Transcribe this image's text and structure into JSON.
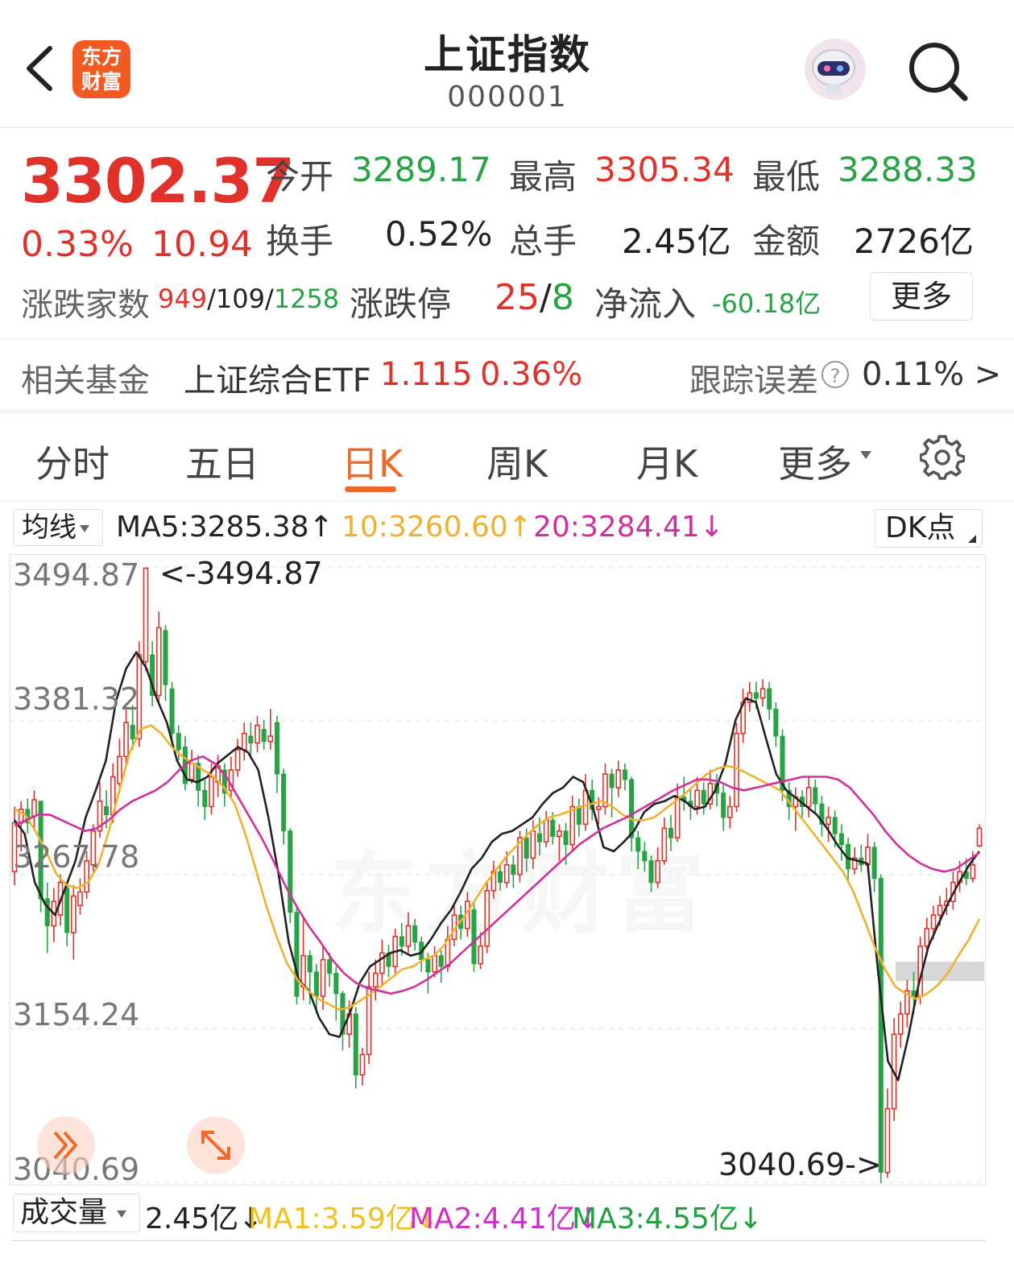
{
  "header": {
    "title": "上证指数",
    "code": "000001",
    "logo_text": "东方财富"
  },
  "quote": {
    "price": "3302.37",
    "change_pct": "0.33%",
    "change": "10.94",
    "open_label": "今开",
    "open": "3289.17",
    "high_label": "最高",
    "high": "3305.34",
    "low_label": "最低",
    "low": "3288.33",
    "turnover_label": "换手",
    "turnover": "0.52%",
    "volume_label": "总手",
    "volume": "2.45亿",
    "amount_label": "金额",
    "amount": "2726亿",
    "updown_label": "涨跌家数",
    "up_count": "949",
    "flat_count": "109",
    "down_count": "1258",
    "limit_label": "涨跌停",
    "limit_up": "25",
    "limit_down": "8",
    "netflow_label": "净流入",
    "netflow": "-60.18亿",
    "more_label": "更多",
    "colors": {
      "up": "#e0312a",
      "down": "#27a245"
    }
  },
  "fund": {
    "label": "相关基金",
    "name": "上证综合ETF",
    "price": "1.115",
    "pct": "0.36%",
    "track_label": "跟踪误差",
    "track_value": "0.11% >"
  },
  "tabs": [
    {
      "label": "分时",
      "active": false
    },
    {
      "label": "五日",
      "active": false
    },
    {
      "label": "日K",
      "active": true
    },
    {
      "label": "周K",
      "active": false
    },
    {
      "label": "月K",
      "active": false
    },
    {
      "label": "更多",
      "active": false
    }
  ],
  "ma": {
    "select_label": "均线",
    "ma5": "MA5:3285.38↑",
    "ma10": "10:3260.60↑",
    "ma20": "20:3284.41↓",
    "dk_label": "DK点",
    "colors": {
      "ma5": "#222222",
      "ma10": "#f0b030",
      "ma20": "#d0309a"
    }
  },
  "chart_data": {
    "type": "candlestick",
    "y_ticks": [
      "3494.87",
      "3381.32",
      "3267.78",
      "3154.24",
      "3040.69"
    ],
    "ylim": [
      3040.69,
      3494.87
    ],
    "high_marker": "<-3494.87",
    "low_marker": "3040.69->",
    "watermark": "东方财富",
    "grid": true,
    "candles": [
      [
        3270,
        3306,
        3318,
        3260
      ],
      [
        3306,
        3316,
        3322,
        3285
      ],
      [
        3316,
        3306,
        3324,
        3298
      ],
      [
        3311,
        3323,
        3330,
        3302
      ],
      [
        3322,
        3250,
        3322,
        3240
      ],
      [
        3250,
        3230,
        3262,
        3210
      ],
      [
        3230,
        3248,
        3258,
        3218
      ],
      [
        3238,
        3262,
        3268,
        3230
      ],
      [
        3258,
        3225,
        3262,
        3215
      ],
      [
        3225,
        3252,
        3260,
        3205
      ],
      [
        3245,
        3255,
        3265,
        3238
      ],
      [
        3255,
        3278,
        3285,
        3250
      ],
      [
        3275,
        3300,
        3305,
        3268
      ],
      [
        3300,
        3322,
        3336,
        3295
      ],
      [
        3318,
        3312,
        3330,
        3302
      ],
      [
        3312,
        3340,
        3350,
        3306
      ],
      [
        3335,
        3355,
        3368,
        3328
      ],
      [
        3355,
        3380,
        3390,
        3348
      ],
      [
        3378,
        3368,
        3393,
        3360
      ],
      [
        3368,
        3430,
        3440,
        3362
      ],
      [
        3425,
        3494,
        3494,
        3418
      ],
      [
        3430,
        3400,
        3440,
        3392
      ],
      [
        3400,
        3450,
        3462,
        3395
      ],
      [
        3448,
        3408,
        3452,
        3396
      ],
      [
        3405,
        3372,
        3410,
        3365
      ],
      [
        3372,
        3360,
        3378,
        3352
      ],
      [
        3362,
        3335,
        3370,
        3330
      ],
      [
        3338,
        3350,
        3360,
        3335
      ],
      [
        3350,
        3330,
        3356,
        3318
      ],
      [
        3330,
        3318,
        3338,
        3308
      ],
      [
        3318,
        3340,
        3350,
        3312
      ],
      [
        3336,
        3348,
        3356,
        3325
      ],
      [
        3345,
        3328,
        3350,
        3318
      ],
      [
        3330,
        3345,
        3355,
        3325
      ],
      [
        3345,
        3360,
        3368,
        3340
      ],
      [
        3360,
        3372,
        3380,
        3352
      ],
      [
        3370,
        3365,
        3380,
        3356
      ],
      [
        3365,
        3378,
        3385,
        3358
      ],
      [
        3375,
        3366,
        3382,
        3360
      ],
      [
        3366,
        3370,
        3390,
        3360
      ],
      [
        3380,
        3342,
        3385,
        3328
      ],
      [
        3342,
        3300,
        3346,
        3290
      ],
      [
        3300,
        3240,
        3302,
        3232
      ],
      [
        3240,
        3178,
        3245,
        3172
      ],
      [
        3185,
        3208,
        3235,
        3175
      ],
      [
        3208,
        3196,
        3212,
        3172
      ],
      [
        3196,
        3178,
        3202,
        3165
      ],
      [
        3178,
        3205,
        3215,
        3168
      ],
      [
        3205,
        3195,
        3210,
        3185
      ],
      [
        3195,
        3180,
        3200,
        3160
      ],
      [
        3180,
        3150,
        3182,
        3138
      ],
      [
        3150,
        3165,
        3175,
        3140
      ],
      [
        3165,
        3120,
        3170,
        3110
      ],
      [
        3120,
        3135,
        3140,
        3112
      ],
      [
        3135,
        3185,
        3196,
        3128
      ],
      [
        3185,
        3195,
        3205,
        3175
      ],
      [
        3195,
        3210,
        3220,
        3185
      ],
      [
        3210,
        3200,
        3216,
        3192
      ],
      [
        3200,
        3222,
        3228,
        3195
      ],
      [
        3222,
        3215,
        3232,
        3208
      ],
      [
        3215,
        3230,
        3240,
        3210
      ],
      [
        3230,
        3218,
        3235,
        3212
      ],
      [
        3218,
        3205,
        3222,
        3196
      ],
      [
        3205,
        3196,
        3210,
        3180
      ],
      [
        3196,
        3208,
        3215,
        3192
      ],
      [
        3208,
        3200,
        3212,
        3188
      ],
      [
        3200,
        3220,
        3230,
        3196
      ],
      [
        3220,
        3238,
        3245,
        3215
      ],
      [
        3238,
        3228,
        3245,
        3220
      ],
      [
        3228,
        3248,
        3255,
        3222
      ],
      [
        3242,
        3202,
        3248,
        3196
      ],
      [
        3202,
        3215,
        3225,
        3198
      ],
      [
        3215,
        3256,
        3262,
        3210
      ],
      [
        3256,
        3270,
        3278,
        3250
      ],
      [
        3270,
        3262,
        3276,
        3256
      ],
      [
        3262,
        3275,
        3285,
        3258
      ],
      [
        3275,
        3268,
        3282,
        3258
      ],
      [
        3268,
        3295,
        3300,
        3262
      ],
      [
        3295,
        3280,
        3302,
        3270
      ],
      [
        3280,
        3300,
        3308,
        3272
      ],
      [
        3298,
        3292,
        3310,
        3282
      ],
      [
        3292,
        3308,
        3315,
        3288
      ],
      [
        3308,
        3296,
        3314,
        3290
      ],
      [
        3296,
        3300,
        3305,
        3278
      ],
      [
        3300,
        3290,
        3306,
        3275
      ],
      [
        3290,
        3318,
        3326,
        3285
      ],
      [
        3318,
        3305,
        3324,
        3296
      ],
      [
        3305,
        3330,
        3342,
        3300
      ],
      [
        3330,
        3316,
        3338,
        3308
      ],
      [
        3316,
        3318,
        3325,
        3305
      ],
      [
        3318,
        3342,
        3350,
        3312
      ],
      [
        3342,
        3332,
        3346,
        3310
      ],
      [
        3332,
        3345,
        3352,
        3325
      ],
      [
        3345,
        3338,
        3350,
        3330
      ],
      [
        3338,
        3295,
        3340,
        3285
      ],
      [
        3295,
        3285,
        3300,
        3272
      ],
      [
        3285,
        3278,
        3292,
        3270
      ],
      [
        3278,
        3262,
        3282,
        3255
      ],
      [
        3262,
        3278,
        3288,
        3258
      ],
      [
        3278,
        3302,
        3310,
        3275
      ],
      [
        3302,
        3295,
        3312,
        3285
      ],
      [
        3295,
        3325,
        3335,
        3292
      ],
      [
        3325,
        3322,
        3340,
        3315
      ],
      [
        3322,
        3318,
        3332,
        3308
      ],
      [
        3318,
        3330,
        3340,
        3312
      ],
      [
        3330,
        3320,
        3336,
        3312
      ],
      [
        3320,
        3335,
        3345,
        3316
      ],
      [
        3335,
        3328,
        3342,
        3318
      ],
      [
        3328,
        3310,
        3334,
        3300
      ],
      [
        3310,
        3318,
        3326,
        3302
      ],
      [
        3318,
        3372,
        3380,
        3314
      ],
      [
        3372,
        3395,
        3405,
        3365
      ],
      [
        3395,
        3402,
        3410,
        3388
      ],
      [
        3402,
        3398,
        3410,
        3390
      ],
      [
        3398,
        3405,
        3412,
        3392
      ],
      [
        3405,
        3390,
        3410,
        3382
      ],
      [
        3390,
        3370,
        3395,
        3362
      ],
      [
        3370,
        3330,
        3375,
        3322
      ],
      [
        3330,
        3318,
        3336,
        3308
      ],
      [
        3318,
        3325,
        3332,
        3300
      ],
      [
        3325,
        3318,
        3330,
        3310
      ],
      [
        3318,
        3332,
        3340,
        3310
      ],
      [
        3332,
        3320,
        3338,
        3312
      ],
      [
        3320,
        3305,
        3326,
        3296
      ],
      [
        3305,
        3310,
        3318,
        3292
      ],
      [
        3310,
        3298,
        3315,
        3288
      ],
      [
        3298,
        3290,
        3305,
        3278
      ],
      [
        3290,
        3272,
        3295,
        3262
      ],
      [
        3272,
        3280,
        3288,
        3268
      ],
      [
        3280,
        3275,
        3290,
        3270
      ],
      [
        3275,
        3288,
        3298,
        3270
      ],
      [
        3288,
        3265,
        3292,
        3255
      ],
      [
        3265,
        3048,
        3268,
        3040
      ],
      [
        3048,
        3095,
        3110,
        3044
      ],
      [
        3095,
        3150,
        3162,
        3086
      ],
      [
        3150,
        3165,
        3174,
        3140
      ],
      [
        3165,
        3182,
        3190,
        3155
      ],
      [
        3182,
        3178,
        3196,
        3165
      ],
      [
        3178,
        3215,
        3222,
        3172
      ],
      [
        3215,
        3228,
        3236,
        3208
      ],
      [
        3228,
        3238,
        3245,
        3220
      ],
      [
        3238,
        3245,
        3252,
        3230
      ],
      [
        3245,
        3248,
        3258,
        3238
      ],
      [
        3248,
        3262,
        3270,
        3242
      ],
      [
        3262,
        3270,
        3278,
        3255
      ],
      [
        3270,
        3265,
        3280,
        3260
      ],
      [
        3265,
        3275,
        3285,
        3262
      ],
      [
        3289,
        3302,
        3305,
        3288
      ]
    ],
    "series": [
      {
        "name": "MA5",
        "values": [
          3308,
          3298,
          3262,
          3246,
          3238,
          3258,
          3278,
          3310,
          3330,
          3352,
          3396,
          3420,
          3432,
          3420,
          3398,
          3380,
          3352,
          3338,
          3336,
          3340,
          3350,
          3356,
          3362,
          3358,
          3345,
          3310,
          3268,
          3218,
          3190,
          3182,
          3162,
          3150,
          3148,
          3165,
          3188,
          3200,
          3205,
          3210,
          3212,
          3208,
          3210,
          3220,
          3232,
          3242,
          3256,
          3272,
          3280,
          3292,
          3298,
          3300,
          3305,
          3310,
          3320,
          3328,
          3332,
          3340,
          3336,
          3316,
          3288,
          3285,
          3292,
          3300,
          3314,
          3320,
          3322,
          3326,
          3322,
          3316,
          3318,
          3330,
          3350,
          3382,
          3398,
          3395,
          3368,
          3342,
          3330,
          3324,
          3318,
          3312,
          3302,
          3290,
          3280,
          3278,
          3276,
          3198,
          3130,
          3116,
          3148,
          3186,
          3215,
          3232,
          3248,
          3262,
          3275,
          3285
        ]
      },
      {
        "name": "MA10",
        "values": [
          3316,
          3312,
          3300,
          3285,
          3268,
          3260,
          3258,
          3262,
          3275,
          3300,
          3330,
          3358,
          3375,
          3378,
          3372,
          3362,
          3355,
          3350,
          3345,
          3340,
          3332,
          3320,
          3298,
          3272,
          3245,
          3222,
          3202,
          3190,
          3182,
          3176,
          3172,
          3168,
          3170,
          3175,
          3180,
          3186,
          3192,
          3198,
          3200,
          3205,
          3208,
          3216,
          3228,
          3238,
          3250,
          3262,
          3272,
          3282,
          3290,
          3298,
          3305,
          3310,
          3312,
          3315,
          3318,
          3320,
          3322,
          3318,
          3312,
          3308,
          3308,
          3310,
          3316,
          3322,
          3328,
          3335,
          3342,
          3346,
          3348,
          3346,
          3342,
          3338,
          3334,
          3330,
          3320,
          3310,
          3300,
          3290,
          3280,
          3270,
          3255,
          3235,
          3215,
          3198,
          3185,
          3180,
          3176,
          3180,
          3186,
          3195,
          3208,
          3220,
          3235
        ]
      },
      {
        "name": "MA20",
        "values": [
          3304,
          3308,
          3312,
          3312,
          3308,
          3304,
          3300,
          3302,
          3308,
          3316,
          3322,
          3326,
          3330,
          3336,
          3345,
          3352,
          3355,
          3350,
          3340,
          3325,
          3310,
          3295,
          3278,
          3260,
          3244,
          3230,
          3218,
          3205,
          3195,
          3188,
          3184,
          3182,
          3180,
          3182,
          3185,
          3190,
          3196,
          3202,
          3210,
          3218,
          3226,
          3234,
          3242,
          3250,
          3258,
          3266,
          3274,
          3282,
          3290,
          3296,
          3302,
          3306,
          3310,
          3315,
          3320,
          3325,
          3330,
          3334,
          3338,
          3338,
          3336,
          3332,
          3330,
          3332,
          3334,
          3336,
          3338,
          3340,
          3340,
          3340,
          3338,
          3332,
          3322,
          3312,
          3300,
          3290,
          3282,
          3276,
          3272,
          3270,
          3272,
          3278,
          3284
        ]
      }
    ]
  },
  "volume": {
    "select_label": "成交量",
    "vol": "2.45亿↓",
    "ma1": "MA1:3.59亿↓",
    "ma2": "MA2:4.41亿↓",
    "ma3": "MA3:4.55亿↓",
    "colors": {
      "ma1": "#f0c020",
      "ma2": "#d030c8",
      "ma3": "#20a040"
    }
  }
}
